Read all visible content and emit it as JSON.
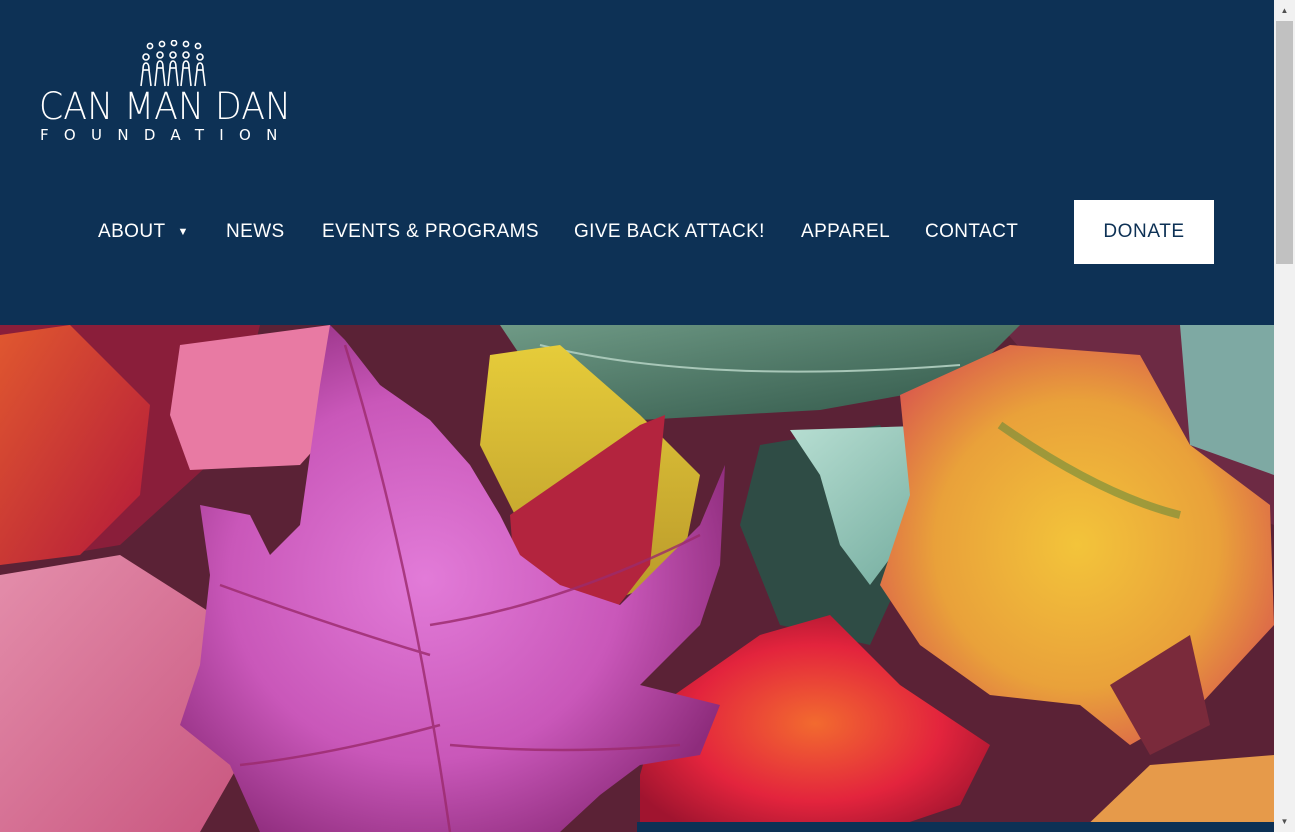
{
  "brand": {
    "wordmark_top": "CAN MAN DAN",
    "wordmark_bottom": "FOUNDATION"
  },
  "nav": {
    "items": [
      {
        "label": "ABOUT",
        "has_dropdown": true
      },
      {
        "label": "NEWS"
      },
      {
        "label": "EVENTS & PROGRAMS"
      },
      {
        "label": "GIVE BACK ATTACK!"
      },
      {
        "label": "APPAREL"
      },
      {
        "label": "CONTACT"
      }
    ],
    "dropdown_glyph": "▼",
    "donate_label": "DONATE"
  },
  "hero": {
    "image": "autumn maple leaves in pink, red, yellow and green"
  },
  "colors": {
    "header_bg": "#0d3155",
    "donate_bg": "#ffffff",
    "donate_text": "#0d3155"
  },
  "icons": {
    "logo_mark": "people-group-icon",
    "dropdown": "caret-down-icon"
  }
}
